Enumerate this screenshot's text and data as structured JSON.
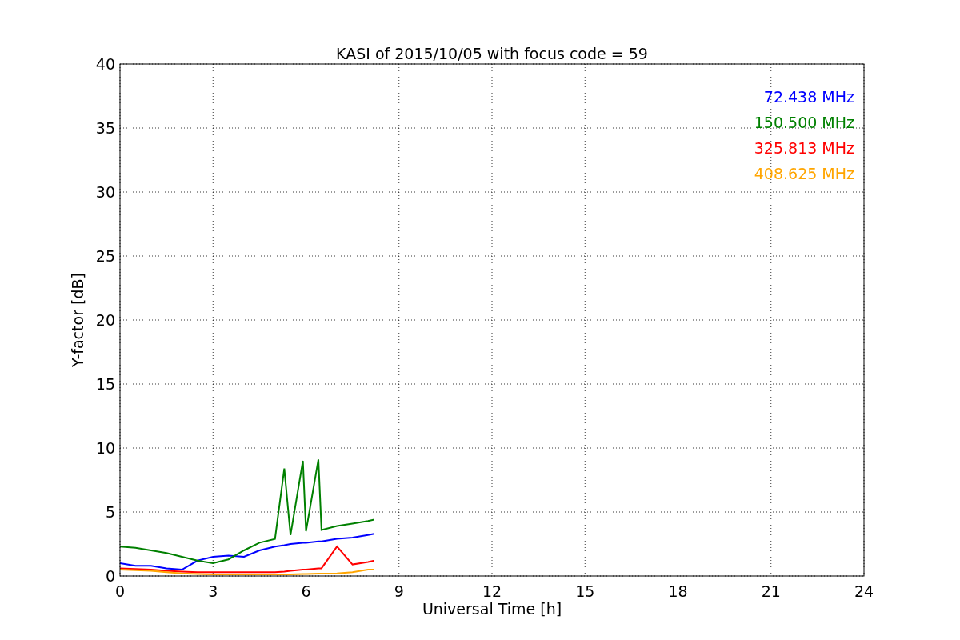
{
  "chart_data": {
    "type": "line",
    "title": "KASI of 2015/10/05 with focus code = 59",
    "xlabel": "Universal Time [h]",
    "ylabel": "Y-factor [dB]",
    "x": [
      0,
      0.5,
      1,
      1.5,
      2,
      2.5,
      3,
      3.5,
      4,
      4.5,
      5,
      5.3,
      5.5,
      5.9,
      6,
      6.4,
      6.5,
      7,
      7.5,
      8,
      8.2
    ],
    "series": [
      {
        "name": "72.438 MHz",
        "color": "#0000ff",
        "values": [
          1.0,
          0.8,
          0.8,
          0.6,
          0.5,
          1.2,
          1.5,
          1.6,
          1.5,
          2.0,
          2.3,
          2.4,
          2.5,
          2.6,
          2.6,
          2.7,
          2.7,
          2.9,
          3.0,
          3.2,
          3.3
        ]
      },
      {
        "name": "150.500 MHz",
        "color": "#008000",
        "values": [
          2.3,
          2.2,
          2.0,
          1.8,
          1.5,
          1.2,
          1.0,
          1.3,
          2.0,
          2.6,
          2.9,
          8.4,
          3.2,
          9.0,
          3.5,
          9.1,
          3.6,
          3.9,
          4.1,
          4.3,
          4.4
        ]
      },
      {
        "name": "325.813 MHz",
        "color": "#ff0000",
        "values": [
          0.6,
          0.55,
          0.5,
          0.4,
          0.35,
          0.3,
          0.3,
          0.3,
          0.3,
          0.3,
          0.3,
          0.35,
          0.4,
          0.5,
          0.5,
          0.6,
          0.6,
          2.3,
          0.9,
          1.1,
          1.2
        ]
      },
      {
        "name": "408.625 MHz",
        "color": "#ffa500",
        "values": [
          0.5,
          0.45,
          0.4,
          0.3,
          0.2,
          0.15,
          0.12,
          0.12,
          0.12,
          0.12,
          0.12,
          0.13,
          0.13,
          0.15,
          0.15,
          0.18,
          0.18,
          0.2,
          0.3,
          0.5,
          0.5
        ]
      }
    ],
    "grid": true,
    "xlim": [
      0,
      24
    ],
    "ylim": [
      0,
      40
    ],
    "xticks": [
      0,
      3,
      6,
      9,
      12,
      15,
      18,
      21,
      24
    ],
    "yticks": [
      0,
      5,
      10,
      15,
      20,
      25,
      30,
      35,
      40
    ]
  }
}
